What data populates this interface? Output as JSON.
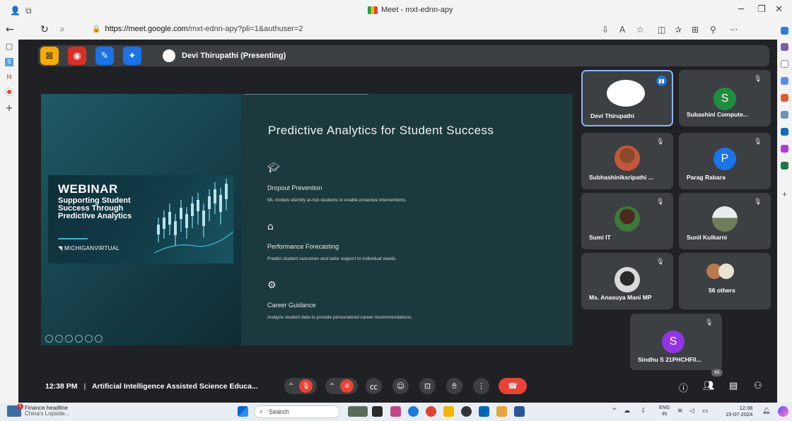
{
  "browser": {
    "tab_title": "Meet - mxt-ednn-apy",
    "url_domain": "https://meet.google.com",
    "url_path": "/mxt-ednn-apy?pli=1&authuser=2"
  },
  "meet": {
    "presenter_label": "Devi Thirupathi (Presenting)",
    "clock": "12:38 PM",
    "meeting_title": "Artificial Intelligence Assisted Science Educa...",
    "participant_count": "65"
  },
  "slide": {
    "webinar_title": "WEBINAR",
    "webinar_subtitle": "Supporting Student Success Through Predictive Analytics",
    "logo_text": "MICHIGANVIRTUAL",
    "title": "Predictive Analytics for Student Success",
    "items": [
      {
        "icon": "graduation-cap-icon",
        "heading": "Dropout Prevention",
        "body": "ML models identify at-risk students to enable proactive interventions."
      },
      {
        "icon": "chart-icon",
        "heading": "Performance Forecasting",
        "body": "Predict student outcomes and tailor support to individual needs."
      },
      {
        "icon": "career-icon",
        "heading": "Career Guidance",
        "body": "Analyze student data to provide personalized career recommendations."
      }
    ]
  },
  "participants": [
    {
      "name": "Devi Thirupathi",
      "avatar": "photo",
      "active": true
    },
    {
      "name": "Subashini Compute...",
      "avatar": "S",
      "color": "#1e8e3e"
    },
    {
      "name": "Subhashiniksripathi ...",
      "avatar": "photo"
    },
    {
      "name": "Parag Rabara",
      "avatar": "P",
      "color": "#1a73e8"
    },
    {
      "name": "Sumi IT",
      "avatar": "photo"
    },
    {
      "name": "Sunil Kulkarni",
      "avatar": "photo"
    },
    {
      "name": "Ms. Anasuya Mani MP",
      "avatar": "photo"
    },
    {
      "name": "56 others",
      "avatar": "group"
    },
    {
      "name": "Sindhu S 21PHCHF0...",
      "avatar": "S",
      "color": "#9334e6"
    }
  ],
  "taskbar": {
    "news_title": "Finance headline",
    "news_sub": "China's Lopside...",
    "news_badge": "1",
    "search_placeholder": "Search",
    "lang": "ENG",
    "region": "IN",
    "time": "12:38",
    "date": "15-07-2024"
  }
}
